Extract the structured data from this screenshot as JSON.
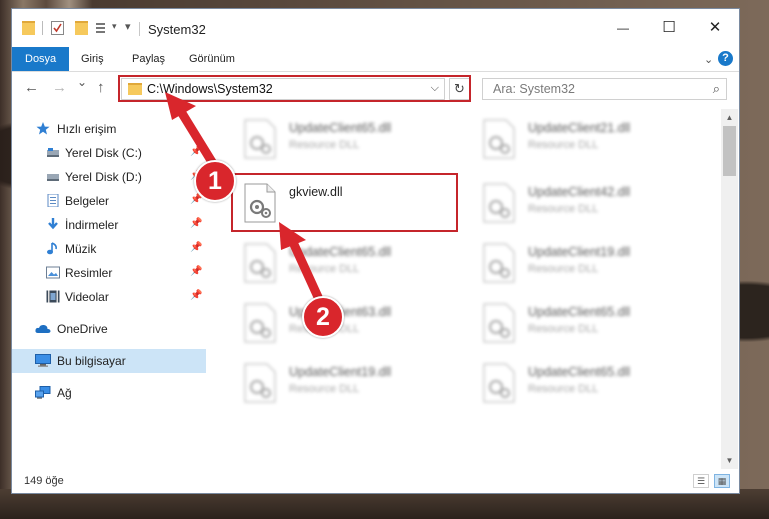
{
  "window": {
    "title": "System32",
    "buttons": {
      "minimize": "—",
      "maximize": "☐",
      "close": "✕"
    }
  },
  "ribbon": {
    "tabs": [
      "Dosya",
      "Giriş",
      "Paylaş",
      "Görünüm"
    ],
    "help": "?"
  },
  "navigation": {
    "back": "←",
    "forward": "→",
    "recent": "⌄",
    "up": "↑",
    "address": "C:\\Windows\\System32",
    "address_dropdown": "⌵",
    "refresh": "↻",
    "search_placeholder": "Ara: System32",
    "search_icon": "⌕"
  },
  "sidebar": {
    "items": [
      {
        "label": "Hızlı erişim",
        "icon": "star-icon",
        "pinned": false,
        "selected": false
      },
      {
        "label": "Yerel Disk (C:)",
        "icon": "drive-icon",
        "pinned": true,
        "selected": false
      },
      {
        "label": "Yerel Disk (D:)",
        "icon": "drive-icon",
        "pinned": true,
        "selected": false
      },
      {
        "label": "Belgeler",
        "icon": "documents-icon",
        "pinned": true,
        "selected": false
      },
      {
        "label": "İndirmeler",
        "icon": "download-icon",
        "pinned": true,
        "selected": false
      },
      {
        "label": "Müzik",
        "icon": "music-icon",
        "pinned": true,
        "selected": false
      },
      {
        "label": "Resimler",
        "icon": "pictures-icon",
        "pinned": true,
        "selected": false
      },
      {
        "label": "Videolar",
        "icon": "videos-icon",
        "pinned": true,
        "selected": false
      },
      {
        "label": "OneDrive",
        "icon": "cloud-icon",
        "pinned": false,
        "selected": false
      },
      {
        "label": "Bu bilgisayar",
        "icon": "computer-icon",
        "pinned": false,
        "selected": true
      },
      {
        "label": "Ağ",
        "icon": "network-icon",
        "pinned": false,
        "selected": false
      }
    ]
  },
  "files": {
    "left_column": [
      {
        "name": "UpdateClient65.dll",
        "type": "Resource DLL",
        "blurred": true
      },
      {
        "name": "gkview.dll",
        "type": "",
        "blurred": false
      },
      {
        "name": "UpdateClient65.dll",
        "type": "Resource DLL",
        "blurred": true
      },
      {
        "name": "UpdateClient63.dll",
        "type": "Resource DLL",
        "blurred": true
      },
      {
        "name": "UpdateClient19.dll",
        "type": "Resource DLL",
        "blurred": true
      }
    ],
    "right_column": [
      {
        "name": "UpdateClient21.dll",
        "type": "Resource DLL",
        "blurred": true
      },
      {
        "name": "UpdateClient42.dll",
        "type": "Resource DLL",
        "blurred": true
      },
      {
        "name": "UpdateClient19.dll",
        "type": "Resource DLL",
        "blurred": true
      },
      {
        "name": "UpdateClient65.dll",
        "type": "Resource DLL",
        "blurred": true
      },
      {
        "name": "UpdateClient65.dll",
        "type": "Resource DLL",
        "blurred": true
      }
    ]
  },
  "status": {
    "item_count": "149 öğe"
  },
  "annotations": {
    "callout_1": "1",
    "callout_2": "2",
    "color": "#d9262c"
  },
  "colors": {
    "accent": "#1979ca",
    "selection": "#cce4f7",
    "highlight_box": "#c5252b"
  }
}
